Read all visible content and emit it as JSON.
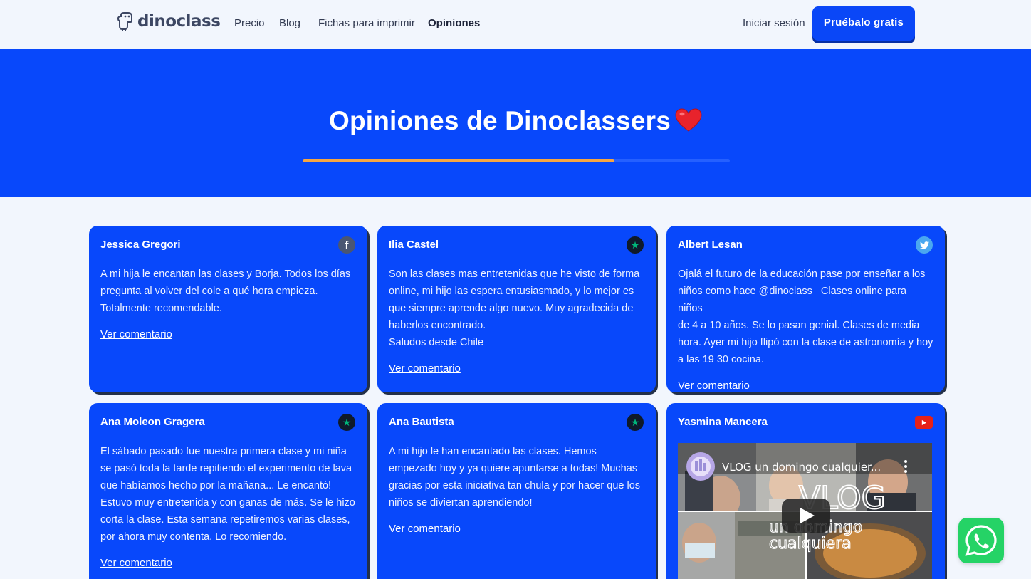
{
  "nav": {
    "logo": "dinoclass",
    "links": [
      "Precio",
      "Blog",
      "Fichas para imprimir",
      "Opiniones"
    ],
    "active": "Opiniones",
    "login": "Iniciar sesión",
    "cta": "Pruébalo gratis"
  },
  "hero": {
    "title": "Opiniones de Dinoclassers",
    "progress": 0.73
  },
  "colors": {
    "primary": "#0848fb",
    "accent": "#f7a641",
    "whatsapp": "#25d366"
  },
  "reviews": [
    {
      "name": "Jessica Gregori",
      "source_icon": "facebook-icon",
      "text": "A mi hija le encantan las clases y Borja. Todos los días\npregunta al volver del cole a qué hora empieza.\nTotalmente recomendable.",
      "link": "Ver comentario"
    },
    {
      "name": "Ilia Castel",
      "source_icon": "trustpilot-icon",
      "text": "Son las clases mas entretenidas que he visto de forma\nonline, mi hijo las espera entusiasmado, y lo mejor es\nque siempre aprende algo nuevo. Muy agradecida de\nhaberlos encontrado.\nSaludos desde Chile",
      "link": "Ver comentario"
    },
    {
      "name": "Albert Lesan",
      "source_icon": "twitter-icon",
      "text": "Ojalá el futuro de la educación pase por enseñar a los\nniños como hace @dinoclass_ Clases online para niños\nde 4 a 10 años. Se lo pasan genial. Clases de media\nhora. Ayer mi hijo flipó con la clase de astronomía y hoy\na las 19 30 cocina.",
      "link": "Ver comentario"
    },
    {
      "name": "Ana Moleon Gragera",
      "source_icon": "trustpilot-icon",
      "text": "El sábado pasado fue nuestra primera clase y mi niña\nse pasó toda la tarde repitiendo el experimento de lava\nque habíamos hecho por la mañana... Le encantó!\nEstuvo muy entretenida y con ganas de más. Se le hizo\ncorta la clase. Esta semana repetiremos varias clases,\npor ahora muy contenta. Lo recomiendo.",
      "link": "Ver comentario"
    },
    {
      "name": "Ana Bautista",
      "source_icon": "trustpilot-icon",
      "text": "A mi hijo le han encantado las clases. Hemos\nempezado hoy y ya quiere apuntarse a todas! Muchas\ngracias por esta iniciativa tan chula y por hacer que los\nniños se diviertan aprendiendo!",
      "link": "Ver comentario"
    },
    {
      "name": "Yasmina Mancera",
      "source_icon": "youtube-icon",
      "video_title": "VLOG un domingo cualquier...",
      "video_overlay_1": "VLOG",
      "video_overlay_2": "un domingo",
      "video_overlay_3": "cualquiera"
    }
  ]
}
